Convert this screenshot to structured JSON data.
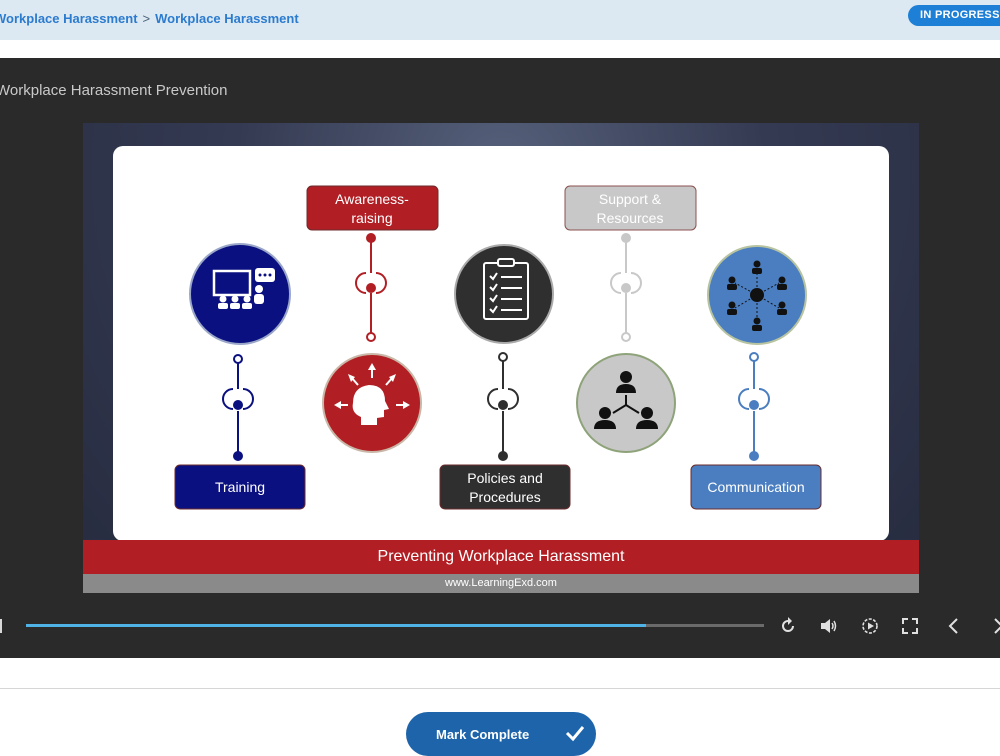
{
  "breadcrumb": {
    "items": [
      "Workplace Harassment",
      "Workplace Harassment"
    ],
    "separator": ">"
  },
  "status_badge": "IN PROGRESS",
  "player": {
    "title": "Workplace Harassment Prevention",
    "progress": 0.84
  },
  "slide": {
    "labels": {
      "training": "Training",
      "awareness_1": "Awareness-",
      "awareness_2": "raising",
      "policies_1": "Policies and",
      "policies_2": "Procedures",
      "support_1": "Support &",
      "support_2": "Resources",
      "communication": "Communication"
    },
    "banner": "Preventing Workplace Harassment",
    "website": "www.LearningExd.com",
    "colors": {
      "navy": "#0b1080",
      "red": "#b11f24",
      "dark": "#2f2f2f",
      "light_gray": "#c8c8c8",
      "steel_blue": "#4a7ec0"
    }
  },
  "controls": {
    "icons": [
      "replay-icon",
      "volume-icon",
      "playback-speed-icon",
      "fullscreen-icon",
      "previous-icon",
      "next-icon"
    ]
  },
  "mark_complete": {
    "label": "Mark Complete"
  }
}
